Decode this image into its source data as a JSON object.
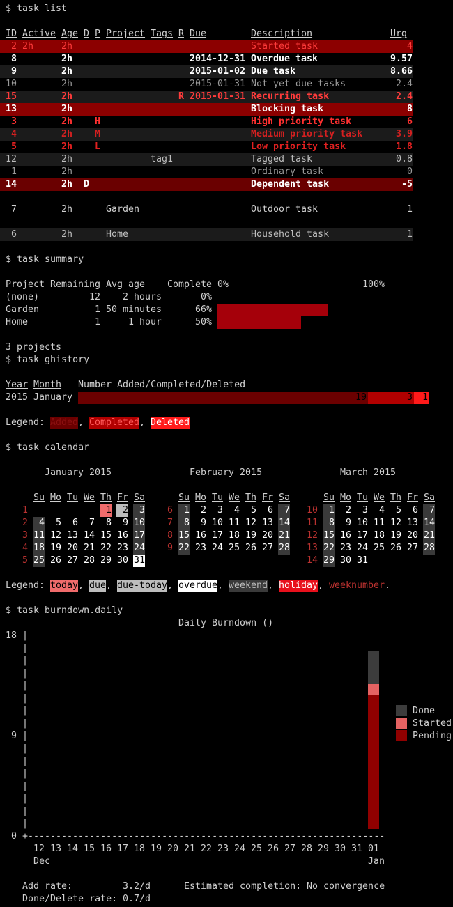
{
  "task_list": {
    "command": "$ task list",
    "header": {
      "id": "ID",
      "active": "Active",
      "age": "Age",
      "d": "D",
      "p": "P",
      "project": "Project",
      "tags": "Tags",
      "r": "R",
      "due": "Due",
      "description": "Description",
      "urg": "Urg"
    },
    "rows": [
      {
        "id": "2",
        "active": "2h",
        "age": "2h",
        "d": "",
        "p": "",
        "project": "",
        "tags": "",
        "r": "",
        "due": "",
        "description": "Started task",
        "urg": "4",
        "style": "started"
      },
      {
        "id": "8",
        "active": "",
        "age": "2h",
        "d": "",
        "p": "",
        "project": "",
        "tags": "",
        "r": "",
        "due": "2014-12-31",
        "description": "Overdue task",
        "urg": "9.57",
        "style": "overdue"
      },
      {
        "id": "9",
        "active": "",
        "age": "2h",
        "d": "",
        "p": "",
        "project": "",
        "tags": "",
        "r": "",
        "due": "2015-01-02",
        "description": "Due task",
        "urg": "8.66",
        "style": "due"
      },
      {
        "id": "10",
        "active": "",
        "age": "2h",
        "d": "",
        "p": "",
        "project": "",
        "tags": "",
        "r": "",
        "due": "2015-01-31",
        "description": "Not yet due tasks",
        "urg": "2.4",
        "style": "notdue"
      },
      {
        "id": "15",
        "active": "",
        "age": "2h",
        "d": "",
        "p": "",
        "project": "",
        "tags": "",
        "r": "R",
        "due": "2015-01-31",
        "description": "Recurring task",
        "urg": "2.4",
        "style": "recurring"
      },
      {
        "id": "13",
        "active": "",
        "age": "2h",
        "d": "",
        "p": "",
        "project": "",
        "tags": "",
        "r": "",
        "due": "",
        "description": "Blocking task",
        "urg": "8",
        "style": "blocking"
      },
      {
        "id": "3",
        "active": "",
        "age": "2h",
        "d": "",
        "p": "H",
        "project": "",
        "tags": "",
        "r": "",
        "due": "",
        "description": "High priority task",
        "urg": "6",
        "style": "pri-h"
      },
      {
        "id": "4",
        "active": "",
        "age": "2h",
        "d": "",
        "p": "M",
        "project": "",
        "tags": "",
        "r": "",
        "due": "",
        "description": "Medium priority task",
        "urg": "3.9",
        "style": "pri-m"
      },
      {
        "id": "5",
        "active": "",
        "age": "2h",
        "d": "",
        "p": "L",
        "project": "",
        "tags": "",
        "r": "",
        "due": "",
        "description": "Low priority task",
        "urg": "1.8",
        "style": "pri-l"
      },
      {
        "id": "12",
        "active": "",
        "age": "2h",
        "d": "",
        "p": "",
        "project": "",
        "tags": "tag1",
        "r": "",
        "due": "",
        "description": "Tagged task",
        "urg": "0.8",
        "style": "tagged"
      },
      {
        "id": "1",
        "active": "",
        "age": "2h",
        "d": "",
        "p": "",
        "project": "",
        "tags": "",
        "r": "",
        "due": "",
        "description": "Ordinary task",
        "urg": "0",
        "style": "ordinary"
      },
      {
        "id": "14",
        "active": "",
        "age": "2h",
        "d": "D",
        "p": "",
        "project": "",
        "tags": "",
        "r": "",
        "due": "",
        "description": "Dependent task",
        "urg": "-5",
        "style": "dependent"
      },
      {
        "id": "7",
        "active": "",
        "age": "2h",
        "d": "",
        "p": "",
        "project": "Garden",
        "tags": "",
        "r": "",
        "due": "",
        "description": "Outdoor task",
        "urg": "1",
        "style": "project-garden"
      },
      {
        "id": "6",
        "active": "",
        "age": "2h",
        "d": "",
        "p": "",
        "project": "Home",
        "tags": "",
        "r": "",
        "due": "",
        "description": "Household task",
        "urg": "1",
        "style": "project-home"
      }
    ]
  },
  "summary": {
    "command": "$ task summary",
    "header": {
      "project": "Project",
      "remaining": "Remaining",
      "avg_age": "Avg age",
      "complete": "Complete",
      "zero": "0%",
      "hundred": "100%"
    },
    "rows": [
      {
        "project": "(none)",
        "remaining": "12",
        "avg_age": "2 hours",
        "complete": "0%",
        "fraction": 0
      },
      {
        "project": "Garden",
        "remaining": "1",
        "avg_age": "50 minutes",
        "complete": "66%",
        "fraction": 0.66
      },
      {
        "project": "Home",
        "remaining": "1",
        "avg_age": "1 hour",
        "complete": "50%",
        "fraction": 0.5
      }
    ],
    "footer": "3 projects"
  },
  "ghistory": {
    "command": "$ task ghistory",
    "header": {
      "year": "Year",
      "month": "Month",
      "label": "Number Added/Completed/Deleted"
    },
    "row": {
      "year": "2015",
      "month": "January",
      "added": "19",
      "completed": "3",
      "deleted": "1"
    },
    "legend_label": "Legend:",
    "legend": [
      "Added",
      "Completed",
      "Deleted"
    ],
    "colors": {
      "added": "#6b0000",
      "completed": "#b20000",
      "deleted": "#ff1a1a"
    }
  },
  "calendar": {
    "command": "$ task calendar",
    "weekdays": [
      "Su",
      "Mo",
      "Tu",
      "We",
      "Th",
      "Fr",
      "Sa"
    ],
    "months": [
      {
        "title": "January 2015",
        "weeks": [
          {
            "wn": "1",
            "days": [
              "",
              "",
              "",
              "",
              "1",
              "2",
              "3"
            ]
          },
          {
            "wn": "2",
            "days": [
              "4",
              "5",
              "6",
              "7",
              "8",
              "9",
              "10"
            ]
          },
          {
            "wn": "3",
            "days": [
              "11",
              "12",
              "13",
              "14",
              "15",
              "16",
              "17"
            ]
          },
          {
            "wn": "4",
            "days": [
              "18",
              "19",
              "20",
              "21",
              "22",
              "23",
              "24"
            ]
          },
          {
            "wn": "5",
            "days": [
              "25",
              "26",
              "27",
              "28",
              "29",
              "30",
              "31"
            ]
          }
        ]
      },
      {
        "title": "February 2015",
        "weeks": [
          {
            "wn": "6",
            "days": [
              "1",
              "2",
              "3",
              "4",
              "5",
              "6",
              "7"
            ]
          },
          {
            "wn": "7",
            "days": [
              "8",
              "9",
              "10",
              "11",
              "12",
              "13",
              "14"
            ]
          },
          {
            "wn": "8",
            "days": [
              "15",
              "16",
              "17",
              "18",
              "19",
              "20",
              "21"
            ]
          },
          {
            "wn": "9",
            "days": [
              "22",
              "23",
              "24",
              "25",
              "26",
              "27",
              "28"
            ]
          }
        ]
      },
      {
        "title": "March 2015",
        "weeks": [
          {
            "wn": "10",
            "days": [
              "1",
              "2",
              "3",
              "4",
              "5",
              "6",
              "7"
            ]
          },
          {
            "wn": "11",
            "days": [
              "8",
              "9",
              "10",
              "11",
              "12",
              "13",
              "14"
            ]
          },
          {
            "wn": "12",
            "days": [
              "15",
              "16",
              "17",
              "18",
              "19",
              "20",
              "21"
            ]
          },
          {
            "wn": "13",
            "days": [
              "22",
              "23",
              "24",
              "25",
              "26",
              "27",
              "28"
            ]
          },
          {
            "wn": "14",
            "days": [
              "29",
              "30",
              "31",
              "",
              "",
              "",
              ""
            ]
          }
        ]
      }
    ],
    "legend_label": "Legend:",
    "legend": [
      "today",
      "due",
      "due-today",
      "overdue",
      "weekend",
      "holiday",
      "weeknumber"
    ],
    "colors": {
      "today": "#f06b6b",
      "due": "#bdbdbd",
      "weekend": "#3a3a3a",
      "holiday": "#e8101c",
      "weeknumber": "#b8312f"
    }
  },
  "burndown": {
    "command": "$ task burndown.daily",
    "title": "Daily Burndown ()",
    "y_ticks": [
      "18",
      "9",
      "0"
    ],
    "x_days": [
      "12",
      "13",
      "14",
      "15",
      "16",
      "17",
      "18",
      "19",
      "20",
      "21",
      "22",
      "23",
      "24",
      "25",
      "26",
      "27",
      "28",
      "29",
      "30",
      "31",
      "01"
    ],
    "x_months": [
      "Dec",
      "Jan"
    ],
    "legend": [
      "Done",
      "Started",
      "Pending"
    ],
    "colors": {
      "done": "#3c3c3c",
      "started": "#e46262",
      "pending": "#900000"
    },
    "stats": {
      "add_rate_label": "Add rate:",
      "add_rate": "3.2/d",
      "done_rate_label": "Done/Delete rate:",
      "done_rate": "0.7/d",
      "est_label": "Estimated completion:",
      "est_value": "No convergence"
    }
  },
  "chart_data": {
    "type": "bar",
    "title": "Daily Burndown ()",
    "categories": [
      "12",
      "13",
      "14",
      "15",
      "16",
      "17",
      "18",
      "19",
      "20",
      "21",
      "22",
      "23",
      "24",
      "25",
      "26",
      "27",
      "28",
      "29",
      "30",
      "31",
      "01"
    ],
    "series": [
      {
        "name": "Pending",
        "values": [
          0,
          0,
          0,
          0,
          0,
          0,
          0,
          0,
          0,
          0,
          0,
          0,
          0,
          0,
          0,
          0,
          0,
          0,
          0,
          0,
          12
        ]
      },
      {
        "name": "Started",
        "values": [
          0,
          0,
          0,
          0,
          0,
          0,
          0,
          0,
          0,
          0,
          0,
          0,
          0,
          0,
          0,
          0,
          0,
          0,
          0,
          0,
          1
        ]
      },
      {
        "name": "Done",
        "values": [
          0,
          0,
          0,
          0,
          0,
          0,
          0,
          0,
          0,
          0,
          0,
          0,
          0,
          0,
          0,
          0,
          0,
          0,
          0,
          0,
          3
        ]
      }
    ],
    "ylim": [
      0,
      18
    ],
    "y_ticks": [
      0,
      9,
      18
    ],
    "legend_position": "right"
  }
}
